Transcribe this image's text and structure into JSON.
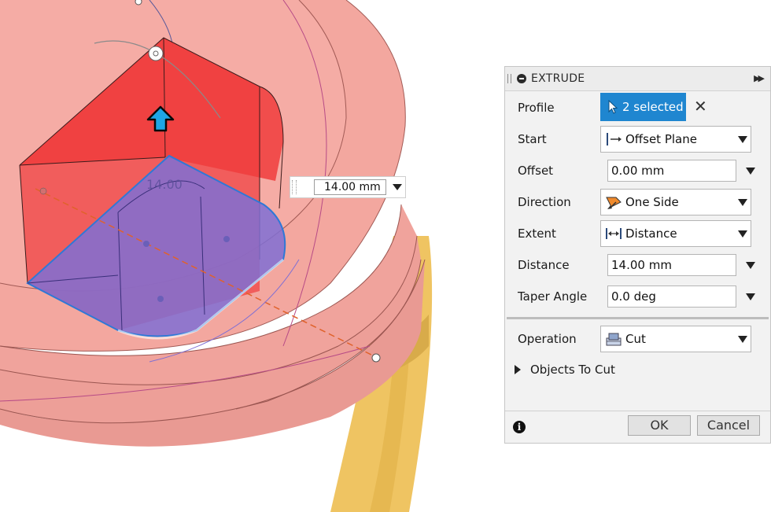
{
  "canvas": {
    "ghost_dimension": "14.00",
    "distance_input": "14.00 mm"
  },
  "dialog": {
    "title": "EXTRUDE",
    "profile": {
      "label": "Profile",
      "selection": "2 selected"
    },
    "start": {
      "label": "Start",
      "value": "Offset Plane",
      "icon": "offset-plane-icon"
    },
    "offset": {
      "label": "Offset",
      "value": "0.00 mm"
    },
    "direction": {
      "label": "Direction",
      "value": "One Side",
      "icon": "one-side-icon"
    },
    "extent": {
      "label": "Extent",
      "value": "Distance",
      "icon": "distance-icon"
    },
    "distance": {
      "label": "Distance",
      "value": "14.00 mm"
    },
    "taper": {
      "label": "Taper Angle",
      "value": "0.0 deg"
    },
    "operation": {
      "label": "Operation",
      "value": "Cut",
      "icon": "cut-icon"
    },
    "objects_to_cut": "Objects To Cut",
    "ok_label": "OK",
    "cancel_label": "Cancel"
  },
  "colors": {
    "body_pink": "#f3a79f",
    "body_yellow": "#efc462",
    "cut_red": "#f04a4a",
    "profile_blue": "#7f6fd4",
    "selection_blue": "#1f86d0"
  }
}
